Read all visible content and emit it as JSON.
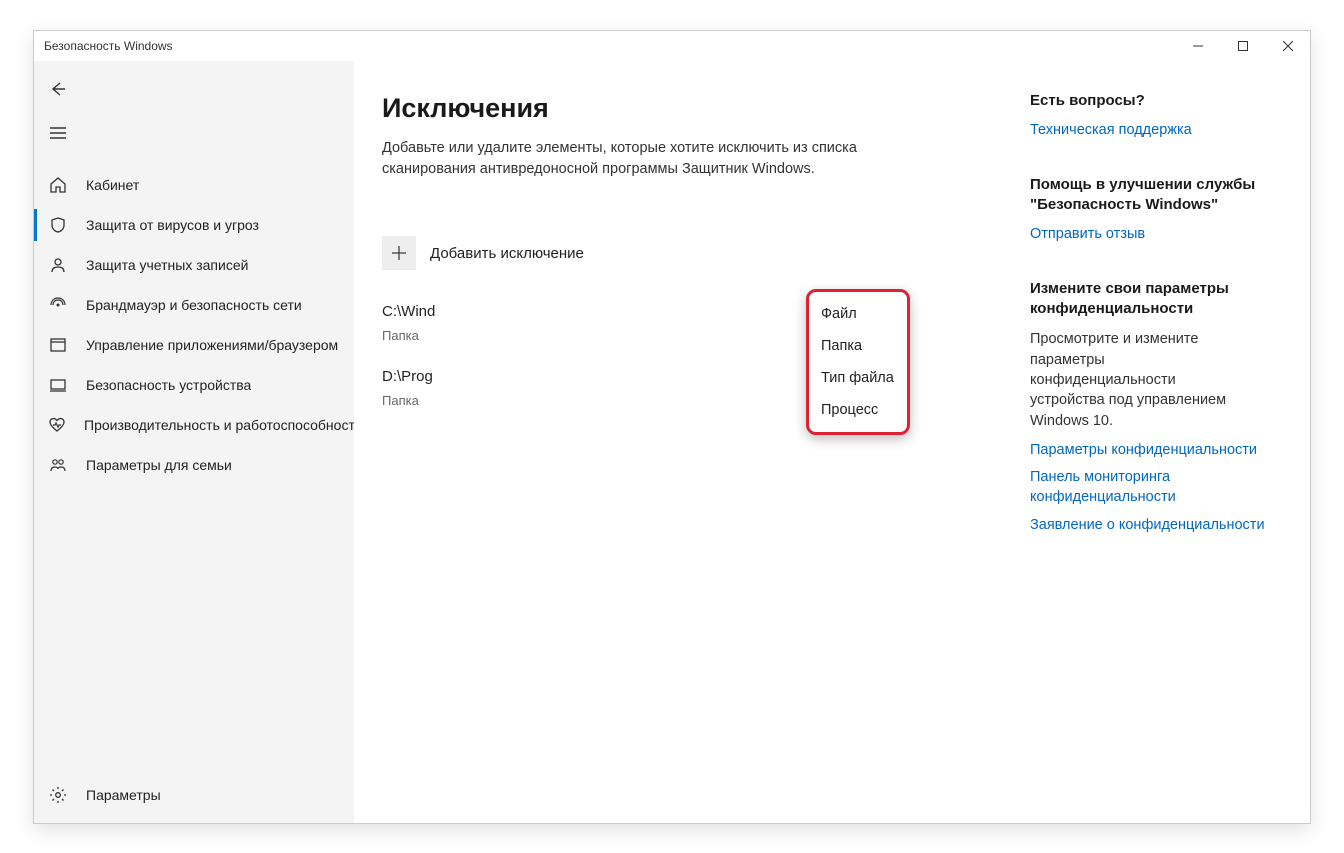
{
  "window": {
    "title": "Безопасность Windows"
  },
  "sidebar": {
    "home": "Кабинет",
    "items": [
      {
        "label": "Защита от вирусов и угроз"
      },
      {
        "label": "Защита учетных записей"
      },
      {
        "label": "Брандмауэр и безопасность сети"
      },
      {
        "label": "Управление приложениями/браузером"
      },
      {
        "label": "Безопасность устройства"
      },
      {
        "label": "Производительность и работоспособность устройства"
      },
      {
        "label": "Параметры для семьи"
      }
    ],
    "settings": "Параметры"
  },
  "content": {
    "title": "Исключения",
    "desc": "Добавьте или удалите элементы, которые хотите исключить из списка сканирования антивредоносной программы Защитник Windows.",
    "add_label": "Добавить исключение",
    "exclusions": [
      {
        "path": "C:\\Wind",
        "type": "Папка"
      },
      {
        "path": "D:\\Prog",
        "type": "Папка"
      }
    ],
    "dropdown": [
      "Файл",
      "Папка",
      "Тип файла",
      "Процесс"
    ]
  },
  "right": {
    "q_title": "Есть вопросы?",
    "q_link": "Техническая поддержка",
    "help_title": "Помощь в улучшении службы \"Безопасность Windows\"",
    "help_link": "Отправить отзыв",
    "priv_title": "Измените свои параметры конфиденциальности",
    "priv_text": "Просмотрите и измените параметры конфиденциальности устройства под управлением Windows 10.",
    "priv_link1": "Параметры конфиденциальности",
    "priv_link2": "Панель мониторинга конфиденциальности",
    "priv_link3": "Заявление о конфиденциальности"
  }
}
